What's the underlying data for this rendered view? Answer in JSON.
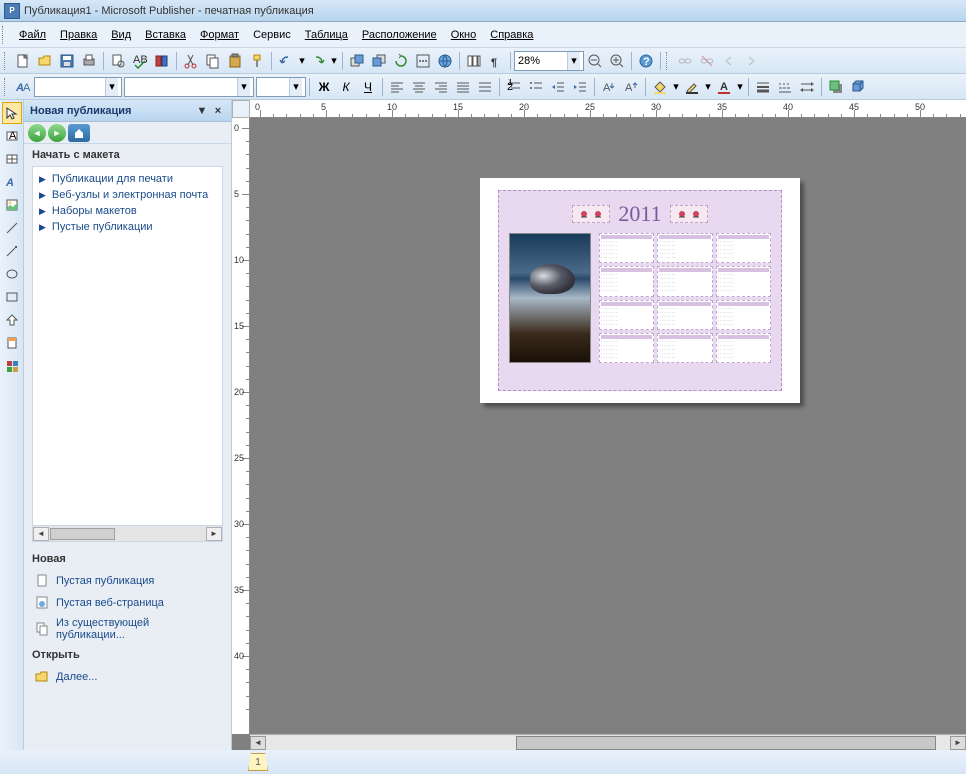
{
  "title": "Публикация1 - Microsoft Publisher - печатная публикация",
  "menu": {
    "file": "Файл",
    "edit": "Правка",
    "view": "Вид",
    "insert": "Вставка",
    "format": "Формат",
    "service": "Сервис",
    "table": "Таблица",
    "arrange": "Расположение",
    "window": "Окно",
    "help": "Справка"
  },
  "toolbar": {
    "zoom": "28%"
  },
  "taskpane": {
    "title": "Новая публикация",
    "section_start": "Начать с макета",
    "items": [
      "Публикации для печати",
      "Веб-узлы и электронная почта",
      "Наборы макетов",
      "Пустые публикации"
    ],
    "section_new": "Новая",
    "new_links": [
      "Пустая публикация",
      "Пустая веб-страница",
      "Из существующей публикации..."
    ],
    "section_open": "Открыть",
    "open_link": "Далее..."
  },
  "calendar": {
    "year": "2011"
  },
  "page_number": "1",
  "hruler_marks": [
    "0",
    "5",
    "10",
    "15",
    "20",
    "25",
    "30",
    "35",
    "40",
    "45",
    "50"
  ],
  "vruler_marks": [
    "0",
    "5",
    "10",
    "15",
    "20",
    "25",
    "30",
    "35",
    "40"
  ]
}
